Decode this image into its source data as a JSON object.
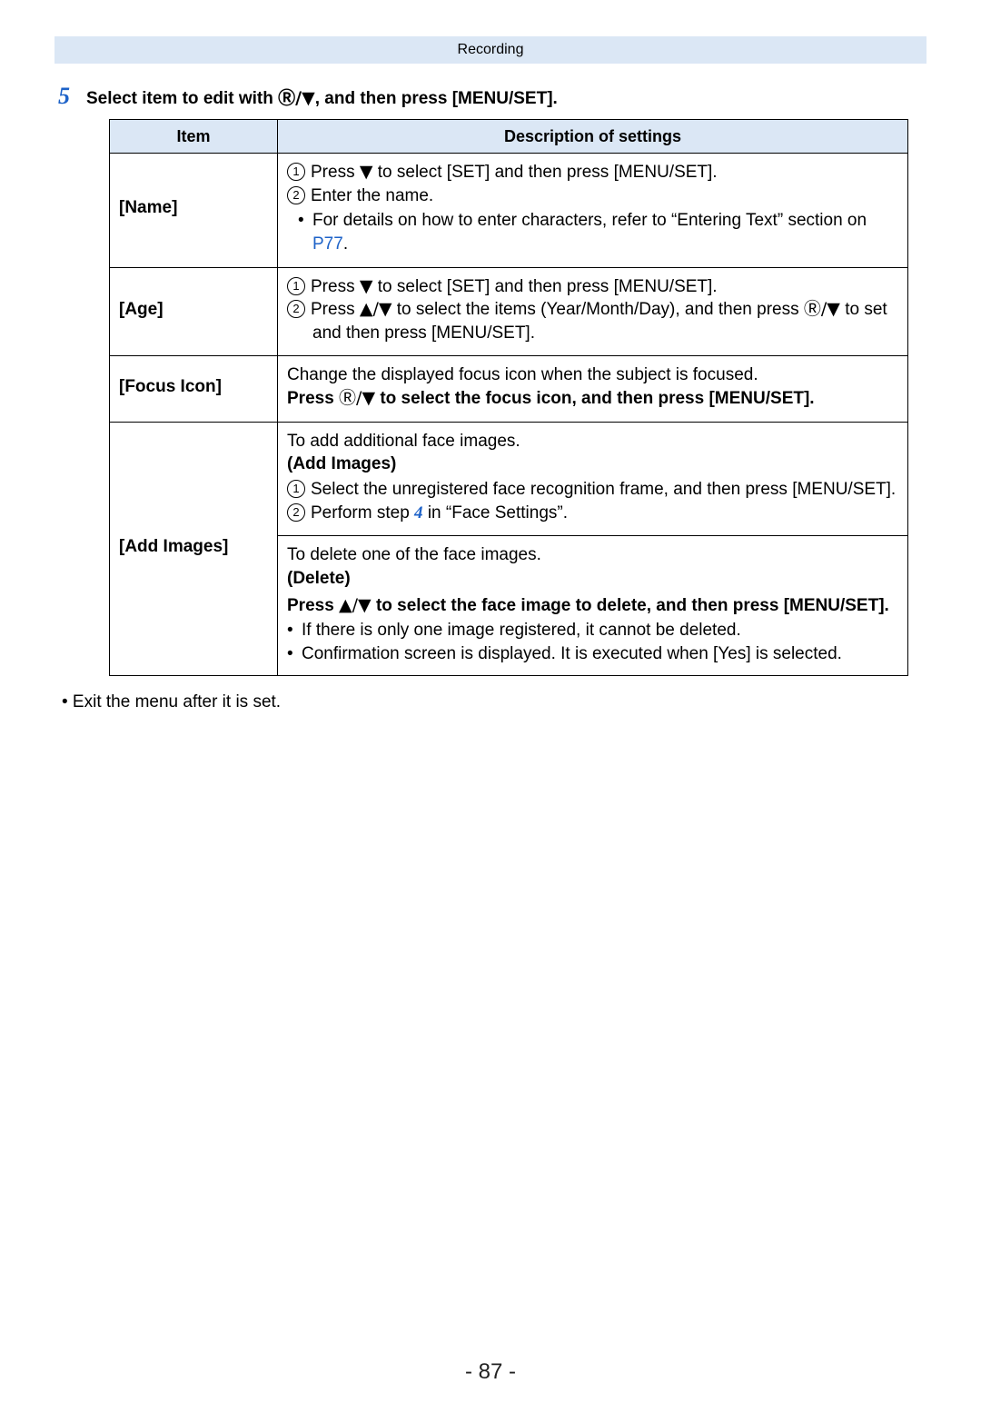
{
  "header": "Recording",
  "step": {
    "number": "5",
    "text_pre": "Select item to edit with ",
    "glyph": "Ⓡ/▼",
    "text_post": ", and then press [MENU/SET]."
  },
  "table": {
    "head_item": "Item",
    "head_desc": "Description of settings",
    "name": {
      "label": "[Name]",
      "l1_pre": "Press ",
      "l1_glyph": "▼",
      "l1_post": " to select [SET] and then press [MENU/SET].",
      "l2": "Enter the name.",
      "l3_pre": "For details on how to enter characters, refer to “Entering Text” section on ",
      "l3_link": "P77",
      "l3_post": "."
    },
    "age": {
      "label": "[Age]",
      "l1_pre": "Press ",
      "l1_glyph": "▼",
      "l1_post": " to select [SET] and then press [MENU/SET].",
      "l2_pre": "Press ",
      "l2_glyph": "▲/▼",
      "l2_post": " to select the items (Year/Month/Day), and then press ",
      "l2_glyph2": "Ⓡ/▼",
      "l2_post2": " to set and then press [MENU/SET]."
    },
    "focus": {
      "label": "[Focus Icon]",
      "l1": "Change the displayed focus icon when the subject is focused.",
      "l2_pre": "Press ",
      "l2_glyph": "Ⓡ/▼",
      "l2_post": " to select the focus icon, and then press [MENU/SET]."
    },
    "add": {
      "label": "[Add Images]",
      "top_l1": "To add additional face images.",
      "top_l2": "(Add Images)",
      "top_sub1": "Select the unregistered face recognition frame, and then press [MENU/SET].",
      "top_sub2_pre": "Perform step ",
      "top_sub2_num": "4",
      "top_sub2_post": " in “Face Settings”.",
      "bot_l1": "To delete one of the face images.",
      "bot_l2": "(Delete)",
      "bot_l3_pre": "Press ",
      "bot_l3_glyph": "▲/▼",
      "bot_l3_post": " to select the face image to delete, and then press [MENU/SET].",
      "bot_l4": "If there is only one image registered, it cannot be deleted.",
      "bot_l5": "Confirmation screen is displayed. It is executed when [Yes] is selected."
    }
  },
  "post_note": "• Exit the menu after it is set.",
  "page_number": "- 87 -"
}
